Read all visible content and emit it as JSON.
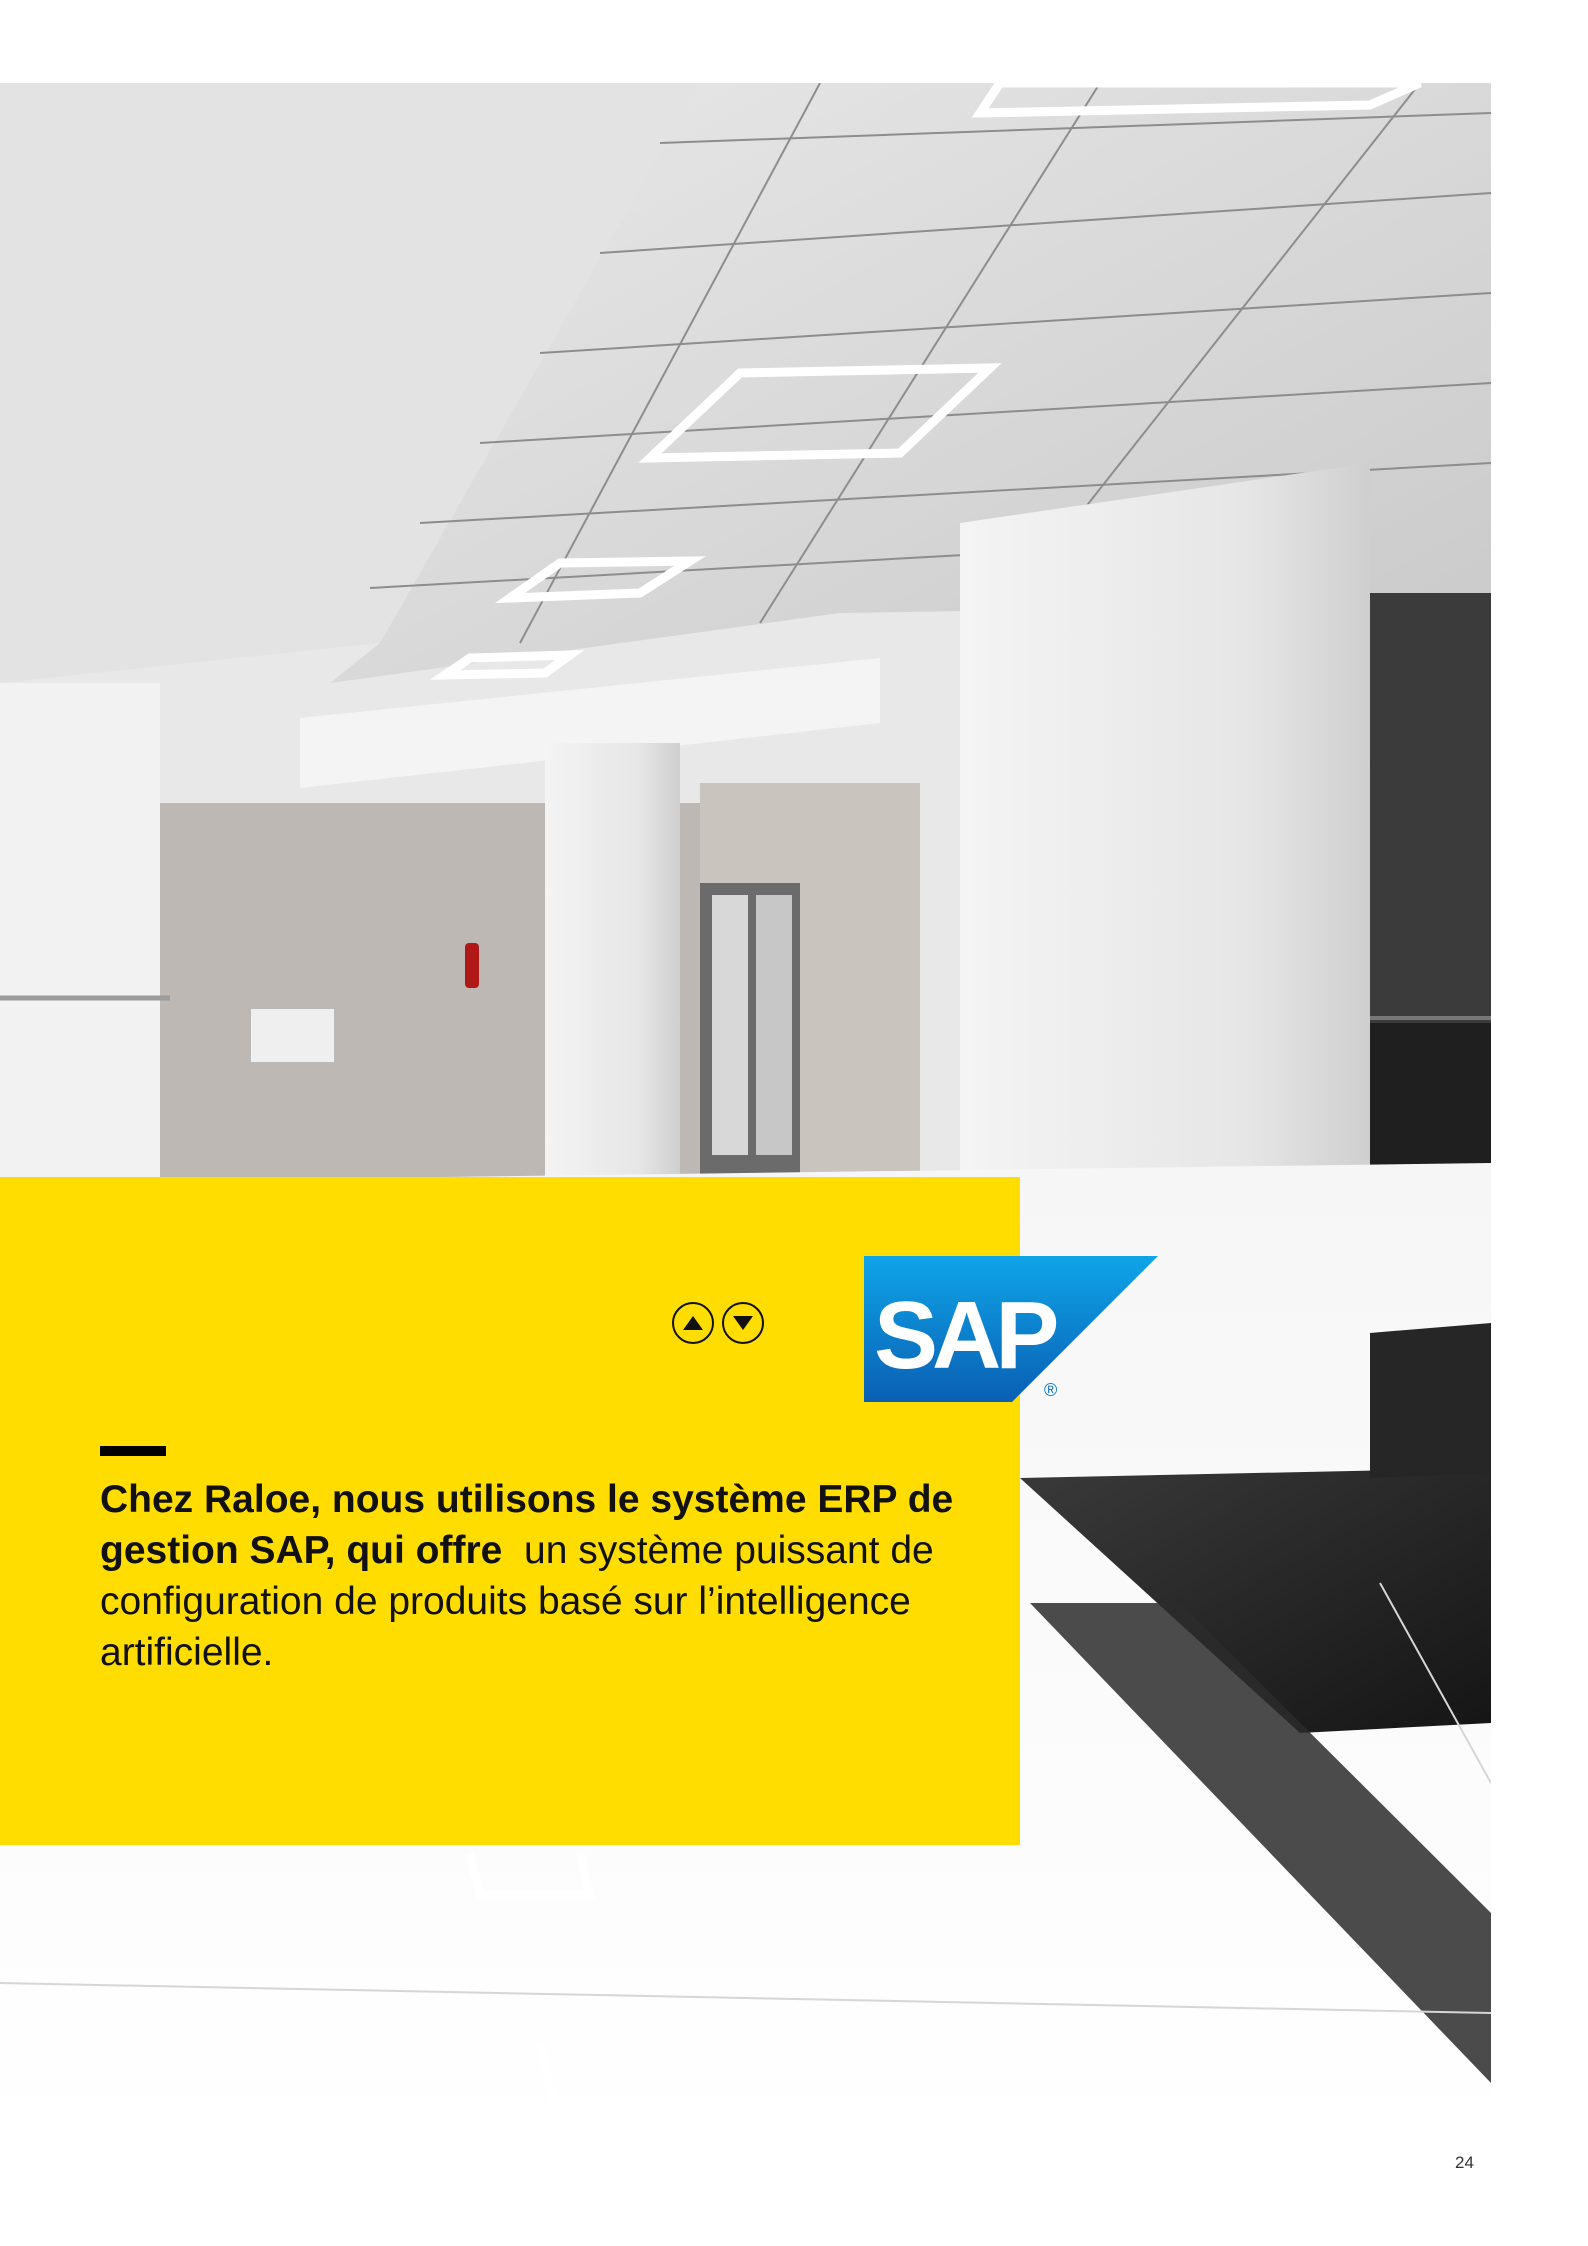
{
  "page": {
    "headline_bold": "Chez Raloe, nous utilisons le système ERP de gestion SAP, qui offre",
    "headline_regular": "un système puissant de configuration de produits basé sur l’intelligence artificielle.",
    "page_number": "24"
  },
  "logo": {
    "text": "SAP",
    "registered": "®"
  },
  "nav": {
    "up_icon": "triangle-up-circle-icon",
    "down_icon": "triangle-down-circle-icon"
  },
  "colors": {
    "panel": "#FFDD00",
    "logo_blue": "#0A75C7",
    "text": "#111111"
  }
}
